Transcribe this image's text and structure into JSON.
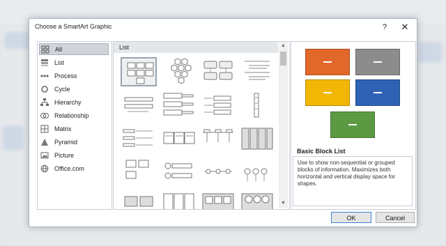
{
  "dialog": {
    "title": "Choose a SmartArt Graphic",
    "help_label": "?",
    "close_label": "✕",
    "ok_label": "OK",
    "cancel_label": "Cancel"
  },
  "categories": [
    {
      "label": "All",
      "icon": "grid-icon",
      "selected": true
    },
    {
      "label": "List",
      "icon": "list-icon"
    },
    {
      "label": "Process",
      "icon": "process-icon"
    },
    {
      "label": "Cycle",
      "icon": "cycle-icon"
    },
    {
      "label": "Hierarchy",
      "icon": "hierarchy-icon"
    },
    {
      "label": "Relationship",
      "icon": "relationship-icon"
    },
    {
      "label": "Matrix",
      "icon": "matrix-icon"
    },
    {
      "label": "Pyramid",
      "icon": "pyramid-icon"
    },
    {
      "label": "Picture",
      "icon": "picture-icon"
    },
    {
      "label": "Office.com",
      "icon": "globe-icon"
    }
  ],
  "gallery": {
    "header": "List",
    "scroll_up": "▲",
    "scroll_down": "▼"
  },
  "preview": {
    "title": "Basic Block List",
    "description": "Use to show non-sequential or grouped blocks of information. Maximizes both horizontal and vertical display space for shapes.",
    "colors": {
      "orange": "#e2672a",
      "gray": "#8c8c8c",
      "yellow": "#f2b705",
      "blue": "#2f62b5",
      "green": "#5b9a43"
    }
  }
}
